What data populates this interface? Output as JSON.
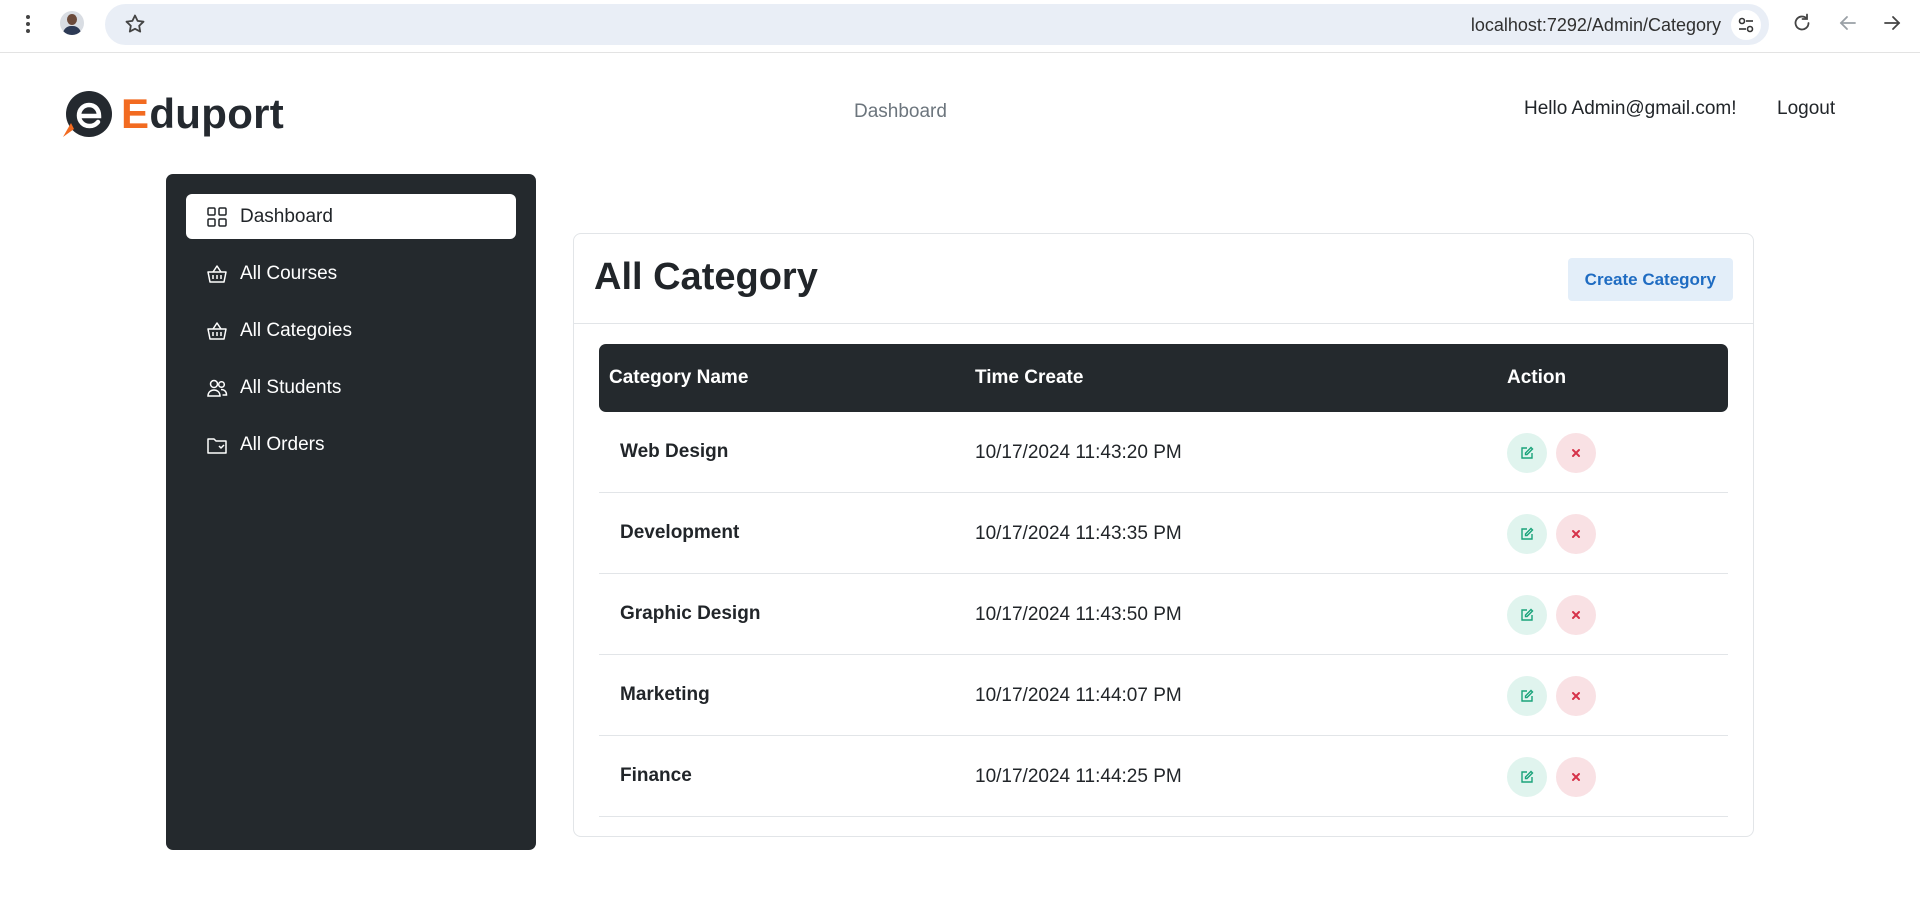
{
  "browser": {
    "url": "localhost:7292/Admin/Category",
    "icons": [
      "menu-icon",
      "profile-avatar",
      "star-icon",
      "tune-icon",
      "reload-icon",
      "back-icon",
      "forward-icon"
    ]
  },
  "header": {
    "logo_letter": "E",
    "logo_rest": "duport",
    "center_link": "Dashboard",
    "greeting": "Hello Admin@gmail.com!",
    "logout": "Logout",
    "accent_color": "#f26b21"
  },
  "sidebar": {
    "items": [
      {
        "label": "Dashboard",
        "icon": "grid-icon",
        "active": true
      },
      {
        "label": "All Courses",
        "icon": "basket-icon",
        "active": false
      },
      {
        "label": "All Categoies",
        "icon": "basket-icon",
        "active": false
      },
      {
        "label": "All Students",
        "icon": "people-icon",
        "active": false
      },
      {
        "label": "All Orders",
        "icon": "folder-icon",
        "active": false
      }
    ]
  },
  "main": {
    "title": "All Category",
    "create_button": "Create Category",
    "table": {
      "columns": [
        "Category Name",
        "Time Create",
        "Action"
      ],
      "rows": [
        {
          "name": "Web Design",
          "time": "10/17/2024 11:43:20 PM"
        },
        {
          "name": "Development",
          "time": "10/17/2024 11:43:35 PM"
        },
        {
          "name": "Graphic Design",
          "time": "10/17/2024 11:43:50 PM"
        },
        {
          "name": "Marketing",
          "time": "10/17/2024 11:44:07 PM"
        },
        {
          "name": "Finance",
          "time": "10/17/2024 11:44:25 PM"
        }
      ]
    }
  }
}
